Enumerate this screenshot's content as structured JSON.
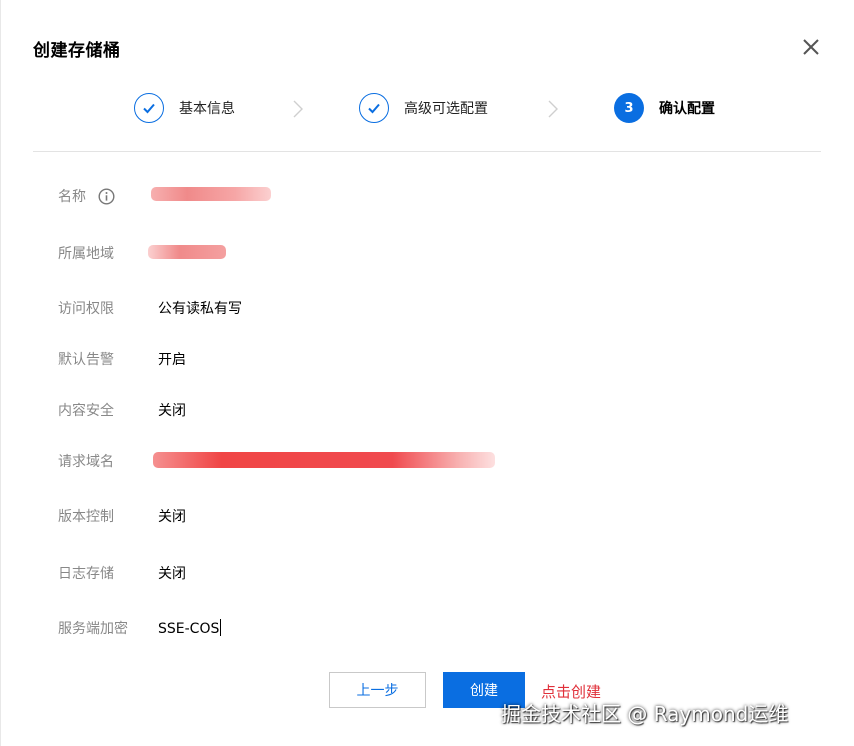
{
  "dialog": {
    "title": "创建存储桶",
    "close_icon": "close-icon"
  },
  "steps": [
    {
      "label": "基本信息",
      "state": "done",
      "icon": "check-icon"
    },
    {
      "label": "高级可选配置",
      "state": "done",
      "icon": "check-icon"
    },
    {
      "label": "确认配置",
      "state": "active",
      "number": "3"
    }
  ],
  "fields": {
    "name": {
      "label": "名称",
      "value": "",
      "info_icon": "info-icon"
    },
    "region": {
      "label": "所属地域",
      "value": ""
    },
    "access": {
      "label": "访问权限",
      "value": "公有读私有写"
    },
    "alarm": {
      "label": "默认告警",
      "value": "开启"
    },
    "content_security": {
      "label": "内容安全",
      "value": "关闭"
    },
    "domain": {
      "label": "请求域名",
      "value": ""
    },
    "versioning": {
      "label": "版本控制",
      "value": "关闭"
    },
    "logging": {
      "label": "日志存储",
      "value": "关闭"
    },
    "encryption": {
      "label": "服务端加密",
      "value": "SSE-COS"
    }
  },
  "footer": {
    "prev_label": "上一步",
    "create_label": "创建",
    "annotation": "点击创建"
  },
  "watermark": "掘金技术社区 @ Raymond运维",
  "colors": {
    "primary": "#0a6ee1",
    "annotation": "#e0303a",
    "redaction": "#f04a4f"
  }
}
